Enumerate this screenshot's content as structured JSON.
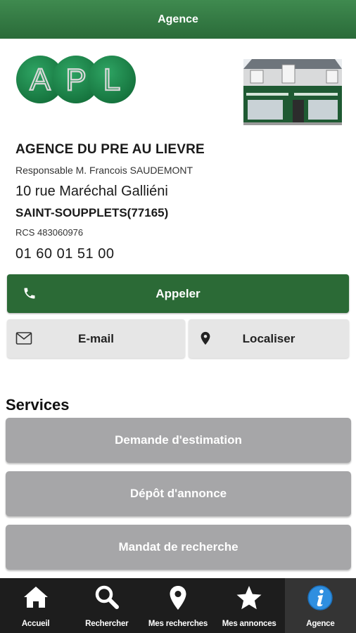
{
  "header": {
    "title": "Agence"
  },
  "logo": {
    "letters": [
      "A",
      "P",
      "L"
    ]
  },
  "agency": {
    "name": "AGENCE DU PRE AU LIEVRE",
    "manager": "Responsable M. Francois SAUDEMONT",
    "address": "10 rue Maréchal Galliéni",
    "city": "SAINT-SOUPPLETS(77165)",
    "rcs": "RCS 483060976",
    "phone": "01 60 01 51 00"
  },
  "actions": {
    "call_label": "Appeler",
    "email_label": "E-mail",
    "locate_label": "Localiser"
  },
  "services": {
    "title": "Services",
    "items": [
      "Demande d'estimation",
      "Dépôt d'annonce",
      "Mandat de recherche"
    ]
  },
  "bottom_nav": {
    "items": [
      {
        "label": "Accueil",
        "icon": "home-icon"
      },
      {
        "label": "Rechercher",
        "icon": "search-icon"
      },
      {
        "label": "Mes recherches",
        "icon": "map-pin-icon"
      },
      {
        "label": "Mes annonces",
        "icon": "star-icon"
      },
      {
        "label": "Agence",
        "icon": "info-icon"
      }
    ],
    "active_index": 4
  },
  "colors": {
    "primary_green": "#2b6a36",
    "service_gray": "#a6a6a8",
    "nav_active_blue": "#2f8fe0"
  }
}
